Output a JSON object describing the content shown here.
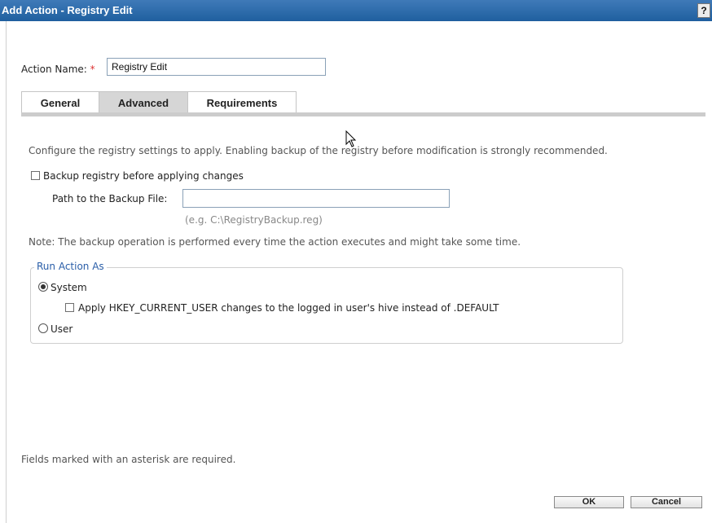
{
  "window": {
    "title": "Add Action - Registry Edit",
    "help_label": "?"
  },
  "form": {
    "action_name_label": "Action Name:",
    "required_mark": "*",
    "action_name_value": "Registry Edit"
  },
  "tabs": [
    {
      "label": "General",
      "selected": false
    },
    {
      "label": "Advanced",
      "selected": true
    },
    {
      "label": "Requirements",
      "selected": false
    }
  ],
  "advanced": {
    "description": "Configure the registry settings to apply. Enabling backup of the registry before modification is strongly recommended.",
    "backup_checkbox_label": "Backup registry before applying changes",
    "backup_checked": false,
    "backup_path_label": "Path to the Backup File:",
    "backup_path_value": "",
    "backup_path_hint": "(e.g. C:\\RegistryBackup.reg)",
    "note": "Note: The backup operation is performed every time the action executes and might take some time.",
    "run_as": {
      "legend": "Run Action As",
      "system_label": "System",
      "system_selected": true,
      "hkcu_label": "Apply HKEY_CURRENT_USER changes to the logged in user's hive instead of .DEFAULT",
      "hkcu_checked": false,
      "user_label": "User",
      "user_selected": false
    }
  },
  "footer": {
    "required_note": "Fields marked with an asterisk are required.",
    "ok_label": "OK",
    "cancel_label": "Cancel"
  },
  "colors": {
    "titlebar": "#2b6aa8",
    "legend": "#2a5ea8",
    "required": "#d33333"
  }
}
